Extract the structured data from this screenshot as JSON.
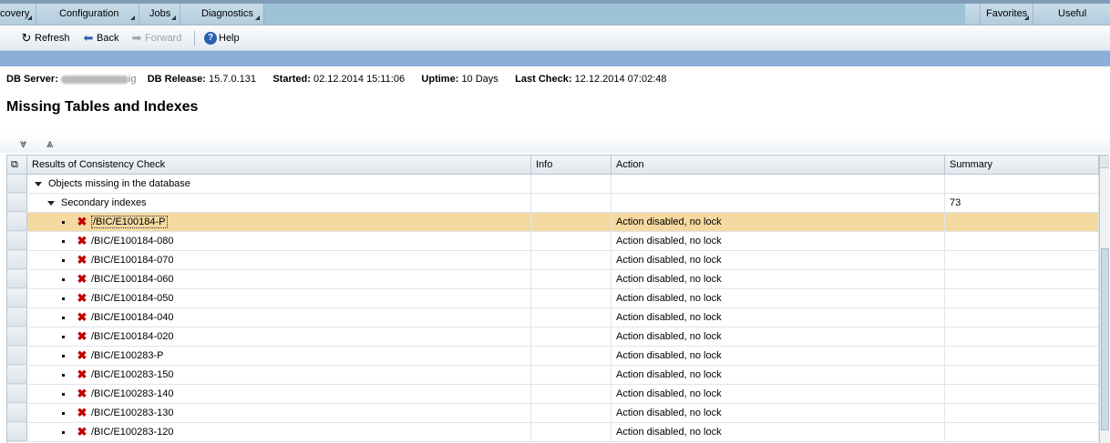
{
  "menu": {
    "items": [
      {
        "label": "covery"
      },
      {
        "label": "Configuration"
      },
      {
        "label": "Jobs"
      },
      {
        "label": "Diagnostics"
      },
      {
        "label": "Favorites"
      },
      {
        "label": "Useful Links"
      }
    ]
  },
  "toolbar": {
    "refresh": "Refresh",
    "back": "Back",
    "forward": "Forward",
    "help": "Help"
  },
  "info": {
    "db_server_label": "DB Server:",
    "db_server_value_tail": "ig",
    "db_release_label": "DB Release:",
    "db_release_value": "15.7.0.131",
    "started_label": "Started:",
    "started_value": "02.12.2014 15:11:06",
    "uptime_label": "Uptime:",
    "uptime_value": "10 Days",
    "last_check_label": "Last Check:",
    "last_check_value": "12.12.2014 07:02:48"
  },
  "page_title": "Missing Tables and Indexes",
  "table": {
    "columns": [
      "Results of Consistency Check",
      "Info",
      "Action",
      "Summary"
    ],
    "group_row": {
      "label": "Objects missing in the database"
    },
    "subgroup_row": {
      "label": "Secondary indexes",
      "summary": "73"
    },
    "rows": [
      {
        "name": "/BIC/E100184-P",
        "action": "Action disabled, no lock",
        "selected": true
      },
      {
        "name": "/BIC/E100184-080",
        "action": "Action disabled, no lock"
      },
      {
        "name": "/BIC/E100184-070",
        "action": "Action disabled, no lock"
      },
      {
        "name": "/BIC/E100184-060",
        "action": "Action disabled, no lock"
      },
      {
        "name": "/BIC/E100184-050",
        "action": "Action disabled, no lock"
      },
      {
        "name": "/BIC/E100184-040",
        "action": "Action disabled, no lock"
      },
      {
        "name": "/BIC/E100184-020",
        "action": "Action disabled, no lock"
      },
      {
        "name": "/BIC/E100283-P",
        "action": "Action disabled, no lock"
      },
      {
        "name": "/BIC/E100283-150",
        "action": "Action disabled, no lock"
      },
      {
        "name": "/BIC/E100283-140",
        "action": "Action disabled, no lock"
      },
      {
        "name": "/BIC/E100283-130",
        "action": "Action disabled, no lock"
      },
      {
        "name": "/BIC/E100283-120",
        "action": "Action disabled, no lock"
      }
    ]
  },
  "icons": {
    "refresh": "refresh-icon",
    "back": "back-arrow-icon",
    "forward": "forward-arrow-icon",
    "help": "help-icon",
    "expand_all": "expand-all-icon",
    "collapse_all": "collapse-all-icon",
    "error": "red-x-icon"
  },
  "colors": {
    "selected_row": "#f4d9a1",
    "error_icon": "#c00000",
    "band": "#8bafd8"
  }
}
